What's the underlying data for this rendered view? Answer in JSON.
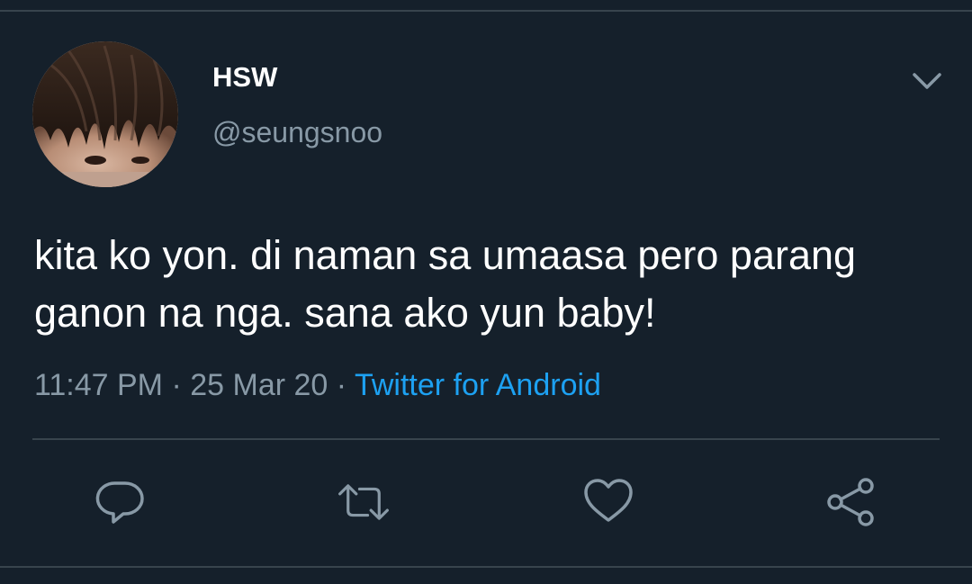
{
  "tweet": {
    "author": {
      "display_name": "HSW",
      "handle": "@seungsnoo",
      "avatar_icon": "profile-photo"
    },
    "text": "kita ko yon. di naman sa umaasa pero parang ganon na nga. sana ako yun baby!",
    "time": "11:47 PM",
    "separator": " · ",
    "date": "25 Mar 20",
    "source": "Twitter for Android"
  },
  "actions": {
    "reply_icon": "comment-icon",
    "retweet_icon": "retweet-icon",
    "like_icon": "heart-icon",
    "share_icon": "share-icon"
  },
  "colors": {
    "background": "#15202b",
    "divider": "#38444d",
    "secondary_text": "#8899a6",
    "link": "#1da1f2",
    "icon": "#8899a6"
  }
}
